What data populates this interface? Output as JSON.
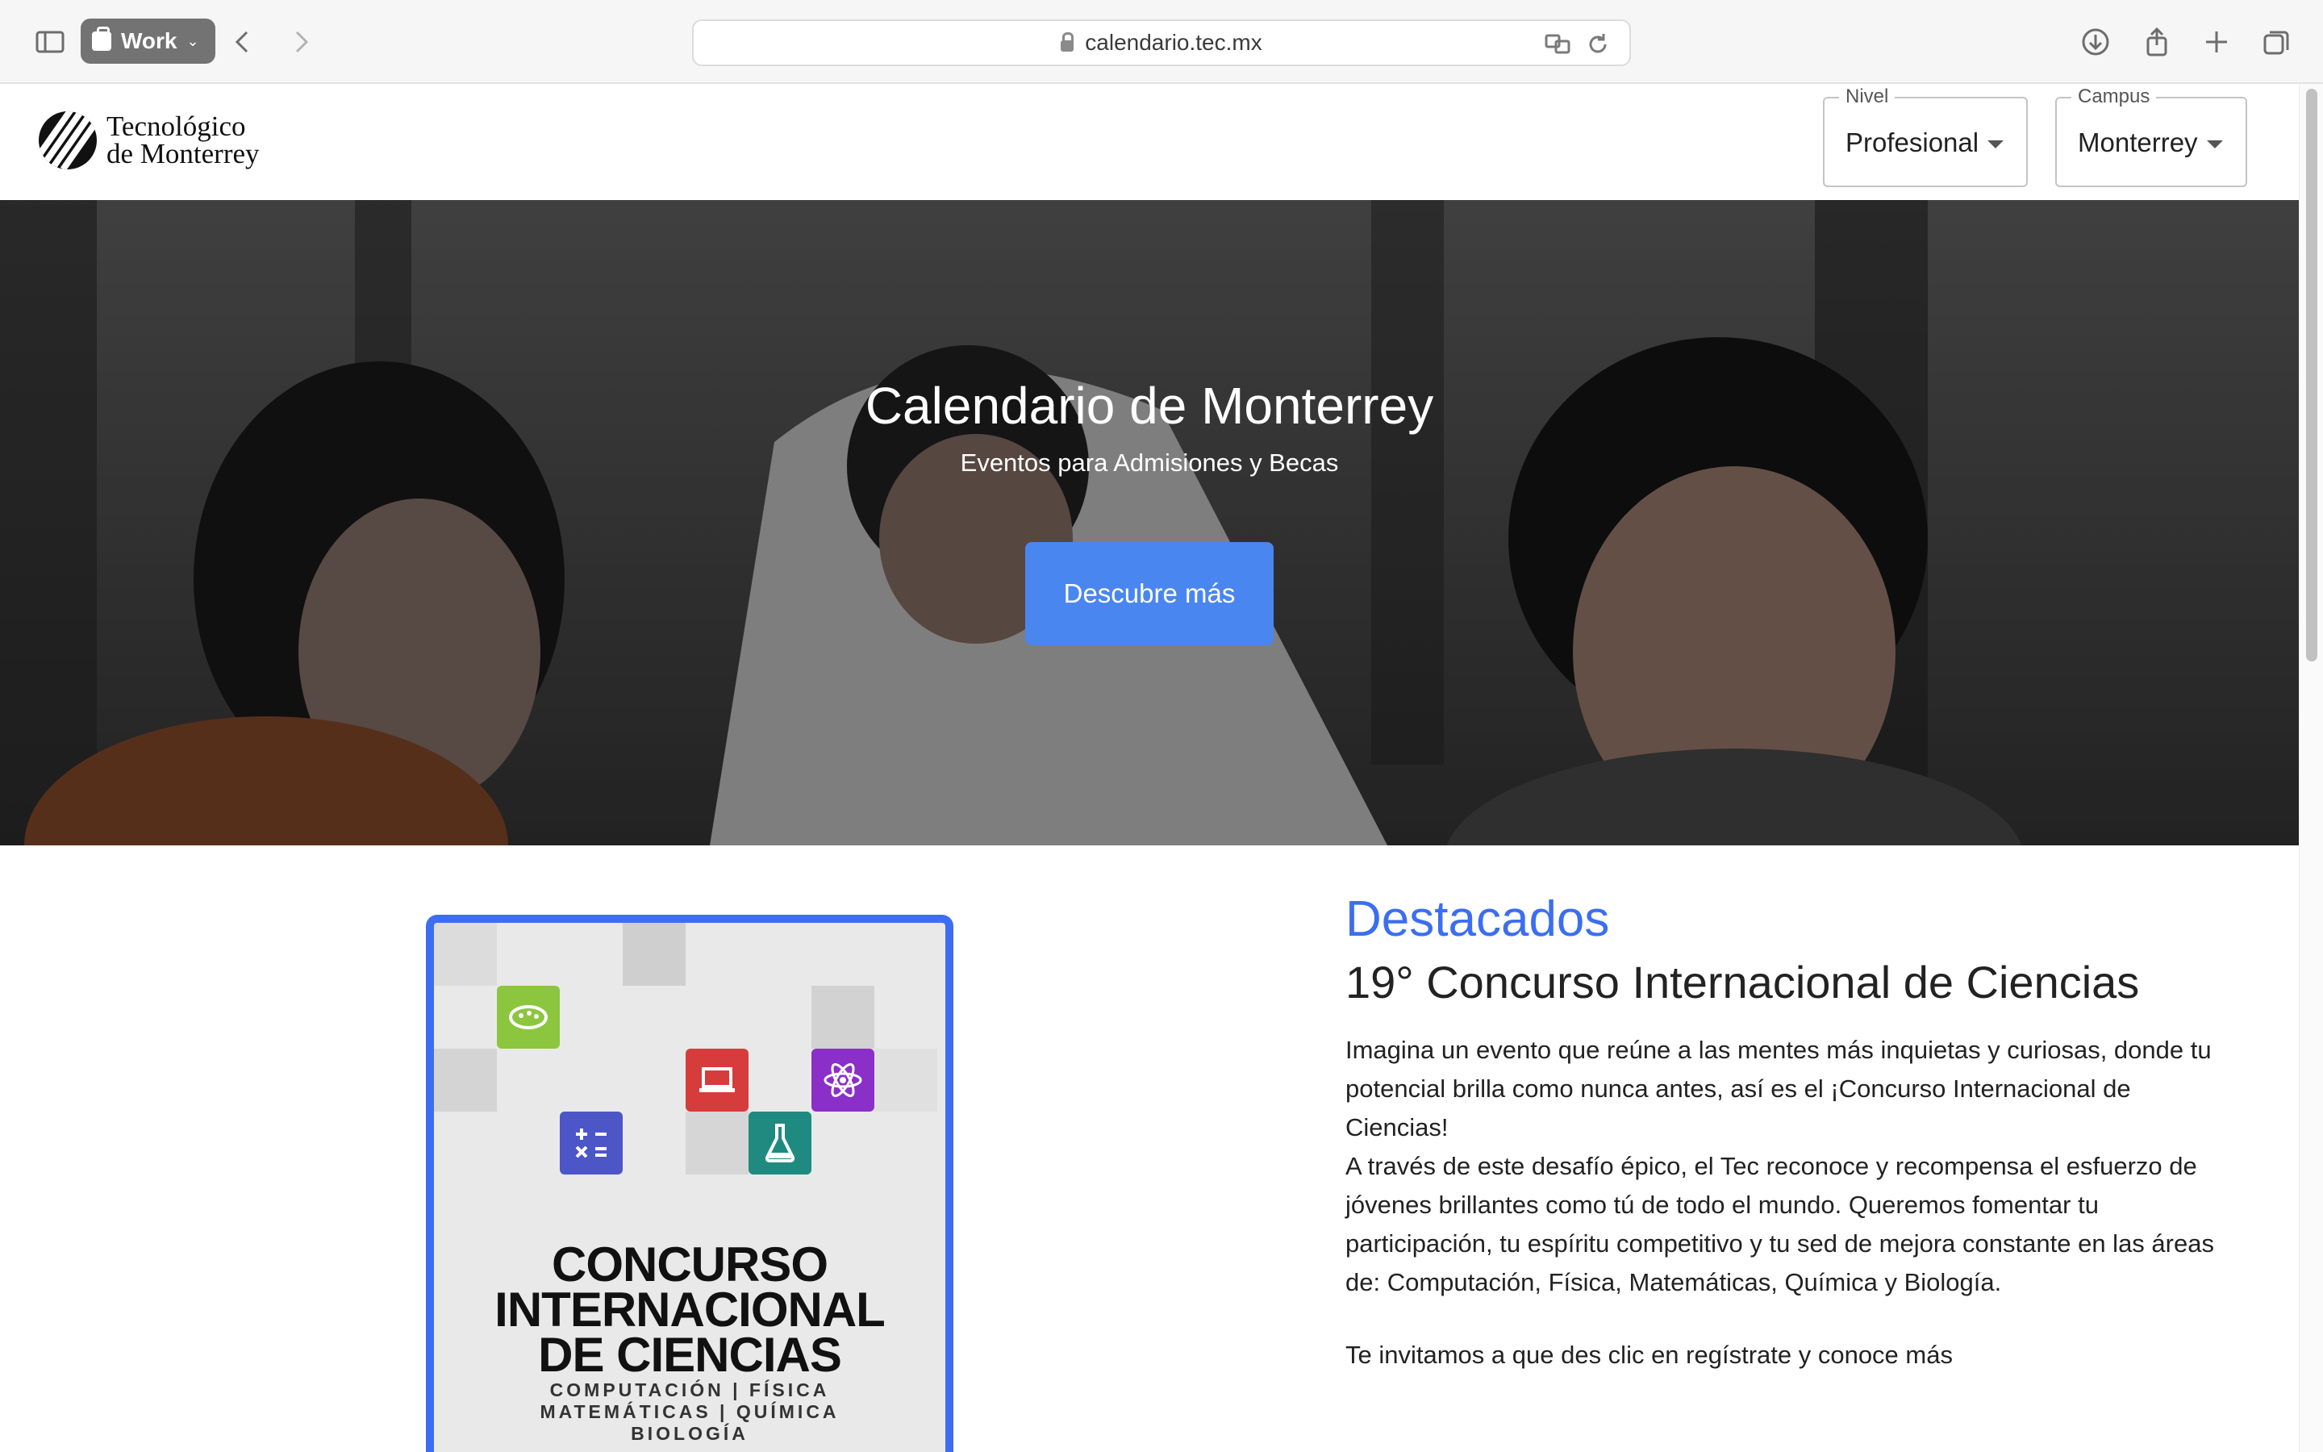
{
  "browser": {
    "tab_group_label": "Work",
    "url": "calendario.tec.mx",
    "icons": [
      "sidebar-icon",
      "back-icon",
      "forward-icon",
      "translate-icon",
      "reload-icon",
      "download-icon",
      "share-icon",
      "new-tab-icon",
      "tab-overview-icon"
    ]
  },
  "header": {
    "logo_line1": "Tecnológico",
    "logo_line2": "de Monterrey",
    "nivel_label": "Nivel",
    "nivel_value": "Profesional",
    "campus_label": "Campus",
    "campus_value": "Monterrey"
  },
  "hero": {
    "title": "Calendario de Monterrey",
    "subtitle": "Eventos para Admisiones y Becas",
    "button": "Descubre más"
  },
  "poster": {
    "title_line1": "CONCURSO",
    "title_line2": "INTERNACIONAL",
    "title_line3": "DE CIENCIAS",
    "sub_line1": "COMPUTACIÓN | FÍSICA",
    "sub_line2": "MATEMÁTICAS | QUÍMICA",
    "sub_line3": "BIOLOGÍA"
  },
  "featured": {
    "heading": "Destacados",
    "title": "19° Concurso Internacional de Ciencias",
    "paragraph1": "Imagina un evento que reúne a las mentes más inquietas y curiosas, donde tu potencial brilla como nunca antes, así es el ¡Concurso Internacional de Ciencias!",
    "paragraph2": "A través de este desafío épico, el Tec reconoce y recompensa el esfuerzo de jóvenes brillantes como tú de todo el mundo. Queremos fomentar tu participación, tu espíritu competitivo y tu sed de mejora constante en las áreas de: Computación, Física, Matemáticas, Química y Biología.",
    "cta": "Te invitamos a que des clic en regístrate y conoce más"
  },
  "colors": {
    "accent_blue": "#3b6ef0",
    "button_blue": "#4a86f0"
  }
}
